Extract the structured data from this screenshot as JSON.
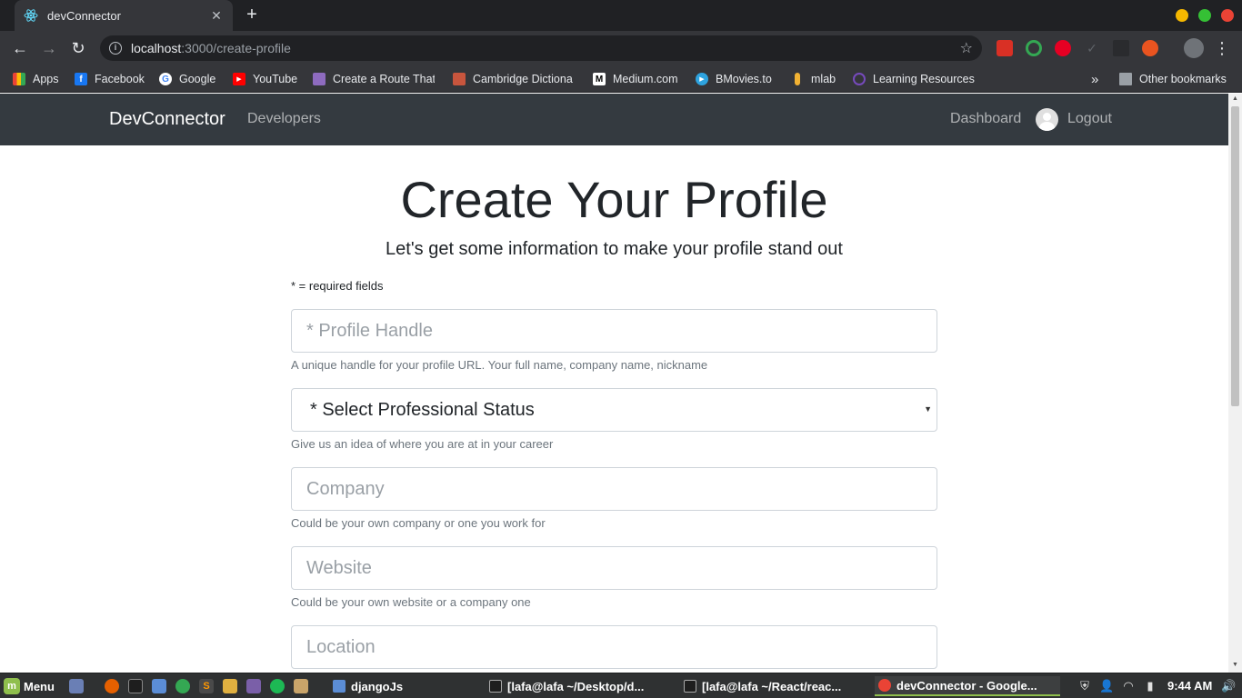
{
  "browser": {
    "tab": {
      "title": "devConnector",
      "favicon": "react-atom-icon"
    },
    "url": {
      "host": "localhost",
      "path": ":3000/create-profile"
    },
    "extensions": [
      "gift-icon",
      "target-icon",
      "pinterest-icon",
      "check-icon",
      "clipboard-icon",
      "ubuntu-icon",
      "profile-avatar-icon"
    ],
    "bookmarks": [
      {
        "label": "Apps",
        "icon": "apps-grid-icon"
      },
      {
        "label": "Facebook",
        "icon": "facebook-icon"
      },
      {
        "label": "Google",
        "icon": "google-icon"
      },
      {
        "label": "YouTube",
        "icon": "youtube-icon"
      },
      {
        "label": "Create a Route That",
        "icon": "cloud-icon"
      },
      {
        "label": "Cambridge Dictiona",
        "icon": "cambridge-icon"
      },
      {
        "label": "Medium.com",
        "icon": "medium-icon"
      },
      {
        "label": "BMovies.to",
        "icon": "play-icon"
      },
      {
        "label": "mlab",
        "icon": "mlab-icon"
      },
      {
        "label": "Learning Resources",
        "icon": "redux-icon"
      }
    ],
    "overflow": "»",
    "other_bookmarks": "Other bookmarks"
  },
  "app": {
    "brand": "DevConnector",
    "nav_developers": "Developers",
    "nav_dashboard": "Dashboard",
    "nav_logout": "Logout"
  },
  "page": {
    "title": "Create Your Profile",
    "lead": "Let's get some information to make your profile stand out",
    "required_note": "* = required fields",
    "fields": {
      "handle": {
        "placeholder": "* Profile Handle",
        "help": "A unique handle for your profile URL. Your full name, company name, nickname"
      },
      "status": {
        "selected": "* Select Professional Status",
        "help": "Give us an idea of where you are at in your career"
      },
      "company": {
        "placeholder": "Company",
        "help": "Could be your own company or one you work for"
      },
      "website": {
        "placeholder": "Website",
        "help": "Could be your own website or a company one"
      },
      "location": {
        "placeholder": "Location"
      }
    }
  },
  "taskbar": {
    "menu": "Menu",
    "windows": [
      {
        "label": "djangoJs",
        "icon": "folder-icon"
      },
      {
        "label": "[lafa@lafa ~/Desktop/d...",
        "icon": "terminal-icon"
      },
      {
        "label": "[lafa@lafa ~/React/reac...",
        "icon": "terminal-icon"
      },
      {
        "label": "devConnector - Google...",
        "icon": "chrome-icon"
      }
    ],
    "clock": "9:44 AM"
  },
  "colors": {
    "navbar": "#343a40",
    "chrome_dark": "#202124",
    "chrome_mid": "#35363a",
    "mint_green": "#8fbf4d"
  }
}
